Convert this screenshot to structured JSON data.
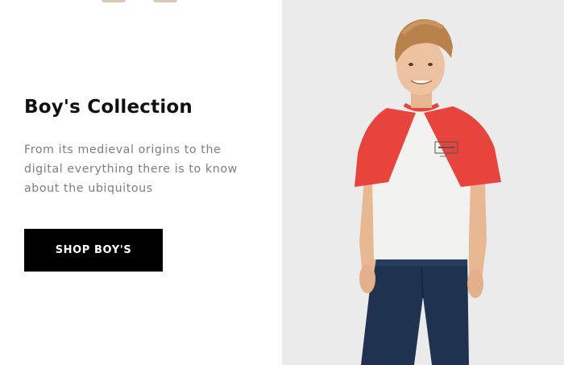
{
  "banner": {
    "heading": "Boy's Collection",
    "description": "From its medieval origins to the digital everything there is to know about the ubiquitous",
    "button_label": "SHOP BOY'S"
  },
  "hero_image": {
    "subject": "boy-in-raglan-tshirt",
    "tshirt_colors": {
      "body": "#f2f2f0",
      "sleeves": "#e6443c"
    },
    "jeans_color": "#1f3350",
    "background": "#ebebec"
  },
  "colors": {
    "heading": "#111111",
    "body_text": "#7d7d7d",
    "button_bg": "#000000",
    "button_text": "#ffffff"
  }
}
